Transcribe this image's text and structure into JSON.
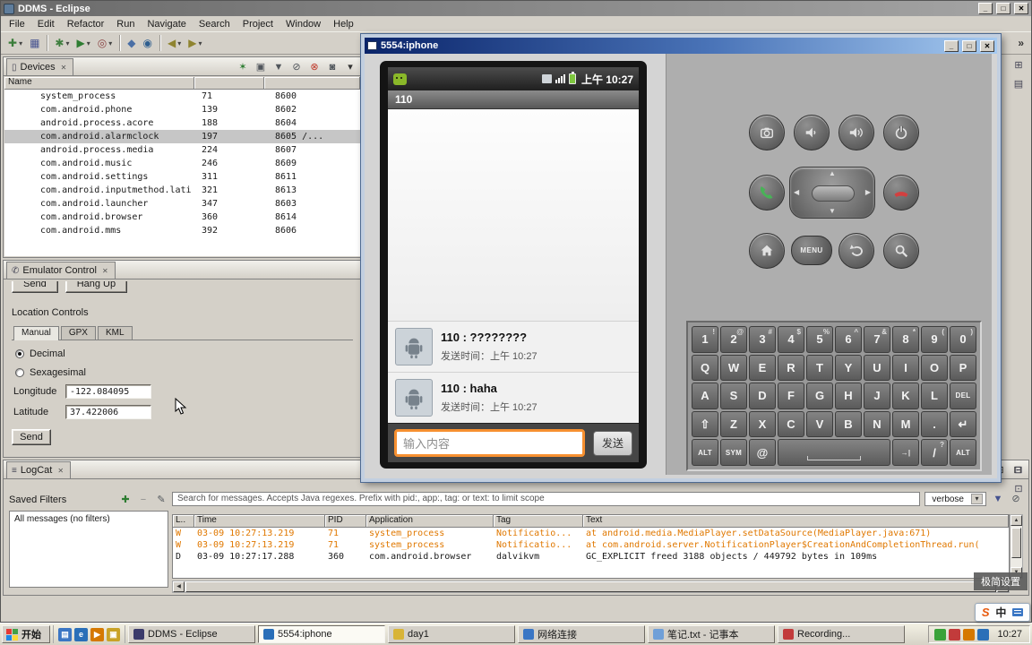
{
  "eclipse": {
    "title": "DDMS - Eclipse",
    "window_buttons": {
      "minimize": "_",
      "maximize": "□",
      "close": "✕"
    },
    "menus": [
      "File",
      "Edit",
      "Refactor",
      "Run",
      "Navigate",
      "Search",
      "Project",
      "Window",
      "Help"
    ],
    "toolbar_overflow": "»",
    "toolbar_groups": [
      [
        {
          "name": "new-wizard-icon",
          "glyph": "✚",
          "color": "#3a7d3a",
          "dropdown": true
        },
        {
          "name": "save-icon",
          "glyph": "▦",
          "color": "#44518f"
        }
      ],
      [
        {
          "name": "debug-icon",
          "glyph": "✱",
          "color": "#3f7f3f",
          "dropdown": true
        },
        {
          "name": "run-icon",
          "glyph": "▶",
          "color": "#2e7d32",
          "dropdown": true
        },
        {
          "name": "external-tools-icon",
          "glyph": "◎",
          "color": "#8a4444",
          "dropdown": true
        }
      ],
      [
        {
          "name": "new-java-class-icon",
          "glyph": "◆",
          "color": "#4a6fa5"
        },
        {
          "name": "search-icon",
          "glyph": "◉",
          "color": "#2f5f8f"
        }
      ],
      [
        {
          "name": "back-icon",
          "glyph": "◀",
          "color": "#8f8430",
          "dropdown": true
        },
        {
          "name": "forward-icon",
          "glyph": "▶",
          "color": "#8f8430",
          "dropdown": true
        }
      ]
    ],
    "fastview_top": [
      {
        "name": "restore-outline-view-icon",
        "glyph": "⊞",
        "color": "#445"
      },
      {
        "name": "restore-properties-view-icon",
        "glyph": "▤",
        "color": "#445"
      }
    ],
    "fastview_bottom": [
      {
        "name": "restore-console-view-icon",
        "glyph": "⊟",
        "color": "#445"
      },
      {
        "name": "restore-tasks-view-icon",
        "glyph": "⊡",
        "color": "#445"
      }
    ],
    "devices": {
      "tab_label": "Devices",
      "tab_icon": "▯",
      "toolbar_icons": [
        {
          "name": "debug-process-icon",
          "glyph": "✶",
          "color": "#2e7d32"
        },
        {
          "name": "update-heap-icon",
          "glyph": "▣",
          "color": "#51565c"
        },
        {
          "name": "dump-hprof-icon",
          "glyph": "▼",
          "color": "#51565c"
        },
        {
          "name": "gc-icon",
          "glyph": "⊘",
          "color": "#51565c"
        },
        {
          "name": "stop-process-icon",
          "glyph": "⊗",
          "color": "#c03a2b"
        },
        {
          "name": "screen-capture-icon",
          "glyph": "◙",
          "color": "#51565c"
        },
        {
          "name": "view-menu-icon",
          "glyph": "▾",
          "color": "#333333"
        }
      ],
      "columns": [
        "Name",
        "",
        ""
      ],
      "selected_row": 3,
      "rows": [
        {
          "name": "system_process",
          "pid": "71",
          "port": "8600"
        },
        {
          "name": "com.android.phone",
          "pid": "139",
          "port": "8602"
        },
        {
          "name": "android.process.acore",
          "pid": "188",
          "port": "8604"
        },
        {
          "name": "com.android.alarmclock",
          "pid": "197",
          "port": "8605 /..."
        },
        {
          "name": "android.process.media",
          "pid": "224",
          "port": "8607"
        },
        {
          "name": "com.android.music",
          "pid": "246",
          "port": "8609"
        },
        {
          "name": "com.android.settings",
          "pid": "311",
          "port": "8611"
        },
        {
          "name": "com.android.inputmethod.lati",
          "pid": "321",
          "port": "8613"
        },
        {
          "name": "com.android.launcher",
          "pid": "347",
          "port": "8603"
        },
        {
          "name": "com.android.browser",
          "pid": "360",
          "port": "8614"
        },
        {
          "name": "com.android.mms",
          "pid": "392",
          "port": "8606"
        }
      ]
    },
    "emulator_control": {
      "tab_label": "Emulator Control",
      "tab_icon": "✆",
      "partial_buttons": [
        "Send",
        "Hang Up"
      ],
      "location_controls": {
        "heading": "Location Controls",
        "tabs": [
          "Manual",
          "GPX",
          "KML"
        ],
        "radios": [
          {
            "label": "Decimal",
            "selected": true
          },
          {
            "label": "Sexagesimal",
            "selected": false
          }
        ],
        "longitude_label": "Longitude",
        "longitude_value": "-122.084095",
        "latitude_label": "Latitude",
        "latitude_value": "37.422006",
        "send_button": "Send"
      }
    },
    "logcat": {
      "tab_label": "LogCat",
      "tab_icon": "≡",
      "saved_filters_heading": "Saved Filters",
      "filter_actions": [
        {
          "name": "add-filter-icon",
          "glyph": "✚",
          "color": "#2e7d32"
        },
        {
          "name": "delete-filter-icon",
          "glyph": "−",
          "color": "#8a8a8a"
        },
        {
          "name": "edit-filter-icon",
          "glyph": "✎",
          "color": "#51565c"
        }
      ],
      "filter_items": [
        "All messages (no filters)"
      ],
      "search_text": "Search for messages. Accepts Java regexes. Prefix with pid:, app:, tag: or text: to limit scope",
      "level_filter": "verbose",
      "toolbar_icons": [
        {
          "name": "save-log-icon",
          "glyph": "▼",
          "color": "#44518f"
        },
        {
          "name": "clear-log-icon",
          "glyph": "⊘",
          "color": "#51565c"
        }
      ],
      "columns": [
        "L..",
        "Time",
        "PID",
        "Application",
        "Tag",
        "Text"
      ],
      "rows": [
        {
          "level": "W",
          "time": "03-09 10:27:13.219",
          "pid": "71",
          "app": "system_process",
          "tag": "Notificatio...",
          "text": "at android.media.MediaPlayer.setDataSource(MediaPlayer.java:671)",
          "kind": "warn"
        },
        {
          "level": "W",
          "time": "03-09 10:27:13.219",
          "pid": "71",
          "app": "system_process",
          "tag": "Notificatio...",
          "text": "at com.android.server.NotificationPlayer$CreationAndCompletionThread.run(",
          "kind": "warn"
        },
        {
          "level": "D",
          "time": "03-09 10:27:17.288",
          "pid": "360",
          "app": "com.android.browser",
          "tag": "dalvikvm",
          "text": "GC_EXPLICIT freed 3188 objects / 449792 bytes in 109ms",
          "kind": "debug"
        }
      ]
    }
  },
  "emulator": {
    "title": "5554:iphone",
    "window_buttons": {
      "minimize": "_",
      "maximize": "□",
      "close": "✕"
    },
    "phone": {
      "status_time": "上午 10:27",
      "app_title": "110",
      "messages": [
        {
          "line": "110 : ????????",
          "time": "发送时间：上午 10:27"
        },
        {
          "line": "110 : haha",
          "time": "发送时间：上午 10:27"
        }
      ],
      "input_hint": "输入内容",
      "send_label": "发送"
    },
    "controls": {
      "menu_label": "MENU"
    },
    "keyboard": [
      [
        {
          "m": "1",
          "s": "!"
        },
        {
          "m": "2",
          "s": "@"
        },
        {
          "m": "3",
          "s": "#"
        },
        {
          "m": "4",
          "s": "$"
        },
        {
          "m": "5",
          "s": "%"
        },
        {
          "m": "6",
          "s": "^"
        },
        {
          "m": "7",
          "s": "&"
        },
        {
          "m": "8",
          "s": "*"
        },
        {
          "m": "9",
          "s": "("
        },
        {
          "m": "0",
          "s": ")"
        }
      ],
      [
        {
          "m": "Q"
        },
        {
          "m": "W"
        },
        {
          "m": "E"
        },
        {
          "m": "R"
        },
        {
          "m": "T"
        },
        {
          "m": "Y"
        },
        {
          "m": "U"
        },
        {
          "m": "I"
        },
        {
          "m": "O"
        },
        {
          "m": "P"
        }
      ],
      [
        {
          "m": "A"
        },
        {
          "m": "S"
        },
        {
          "m": "D"
        },
        {
          "m": "F"
        },
        {
          "m": "G"
        },
        {
          "m": "H"
        },
        {
          "m": "J"
        },
        {
          "m": "K"
        },
        {
          "m": "L"
        },
        {
          "m": "DEL",
          "n": "del",
          "small": true
        }
      ],
      [
        {
          "m": "⇧",
          "n": "shift"
        },
        {
          "m": "Z"
        },
        {
          "m": "X"
        },
        {
          "m": "C"
        },
        {
          "m": "V"
        },
        {
          "m": "B"
        },
        {
          "m": "N"
        },
        {
          "m": "M"
        },
        {
          "m": ".",
          "n": "period"
        },
        {
          "m": "↵",
          "n": "enter"
        }
      ],
      [
        {
          "m": "ALT",
          "n": "alt-left",
          "small": true
        },
        {
          "m": "SYM",
          "n": "sym",
          "small": true
        },
        {
          "m": "@",
          "n": "at"
        },
        {
          "m": "",
          "n": "space",
          "space": true,
          "w": 4
        },
        {
          "m": "→|",
          "n": "tab",
          "small": true
        },
        {
          "m": "/",
          "s": "?",
          "n": "slash"
        },
        {
          "m": "ALT",
          "n": "alt-right",
          "small": true
        }
      ]
    ]
  },
  "taskbar": {
    "start_label": "开始",
    "quick_launch": [
      {
        "name": "show-desktop-icon",
        "glyph": "▤",
        "color": "#3a76c4"
      },
      {
        "name": "ie-icon",
        "glyph": "e",
        "color": "#2a6fb8"
      },
      {
        "name": "media-player-icon",
        "glyph": "▶",
        "color": "#d57800"
      },
      {
        "name": "folder-shortcut-icon",
        "glyph": "▣",
        "color": "#c9a227"
      }
    ],
    "tasks": [
      {
        "id": "ddms-eclipse",
        "label": "DDMS - Eclipse",
        "icon_color": "#3b3b6b",
        "active": false
      },
      {
        "id": "emulator-5554-iphone",
        "label": "5554:iphone",
        "icon_color": "#2a6fb8",
        "active": true
      },
      {
        "id": "day1-folder",
        "label": "day1",
        "icon_color": "#d8b437",
        "active": false
      },
      {
        "id": "network-connections",
        "label": "网络连接",
        "icon_color": "#3a76c4",
        "active": false
      },
      {
        "id": "notepad",
        "label": "笔记.txt - 记事本",
        "icon_color": "#6f9fd8",
        "active": false
      },
      {
        "id": "recording",
        "label": "Recording...",
        "icon_color": "#c23b3b",
        "active": false
      }
    ],
    "tray_icons": [
      {
        "name": "tray-security-icon",
        "color": "#3aa23a"
      },
      {
        "name": "tray-music-icon",
        "color": "#c23b3b"
      },
      {
        "name": "tray-update-icon",
        "color": "#d57800"
      },
      {
        "name": "tray-network-icon",
        "color": "#2a6fb8"
      }
    ],
    "clock": "10:27"
  },
  "overlays": {
    "mini_settings_label": "极简设置",
    "ime": {
      "logo": "S",
      "lang": "中"
    }
  }
}
